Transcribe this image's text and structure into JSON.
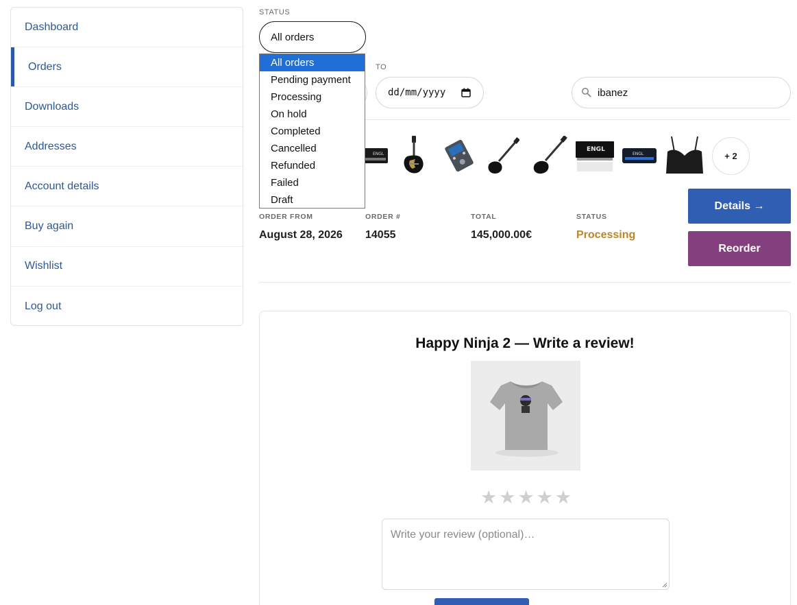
{
  "sidebar": {
    "items": [
      {
        "label": "Dashboard"
      },
      {
        "label": "Orders"
      },
      {
        "label": "Downloads"
      },
      {
        "label": "Addresses"
      },
      {
        "label": "Account details"
      },
      {
        "label": "Buy again"
      },
      {
        "label": "Wishlist"
      },
      {
        "label": "Log out"
      }
    ],
    "active": "Orders"
  },
  "filters": {
    "status_label": "STATUS",
    "status_selected": "All orders",
    "to_label": "TO",
    "date_placeholder": "dd/mm/yyyy",
    "search_value": "ibanez",
    "status_options": [
      "All orders",
      "Pending payment",
      "Processing",
      "On hold",
      "Completed",
      "Cancelled",
      "Refunded",
      "Failed",
      "Draft"
    ]
  },
  "order": {
    "thumbnail_icons": [
      "amp-head-icon",
      "electric-guitar-icon",
      "guitar-pedal-icon",
      "bass-guitar-icon",
      "electric-guitar-icon",
      "amp-head-icon",
      "amp-head-icon",
      "sports-bra-icon"
    ],
    "more_items": "+ 2",
    "order_from_label": "ORDER FROM",
    "order_from": "August 28, 2026",
    "order_no_label": "ORDER #",
    "order_no": "14055",
    "total_label": "TOTAL",
    "total": "145,000.00€",
    "status_label": "STATUS",
    "status": "Processing",
    "details_button": "Details →",
    "reorder_button": "Reorder"
  },
  "review": {
    "title": "Happy Ninja 2 — Write a review!",
    "rating": 0,
    "max_rating": 5,
    "textarea_placeholder": "Write your review (optional)…"
  },
  "colors": {
    "link": "#2d5896",
    "primary_button": "#2f5eb3",
    "reorder_button": "#843f7e",
    "status_processing": "#b8862a",
    "dropdown_selected": "#1f6fd6"
  }
}
